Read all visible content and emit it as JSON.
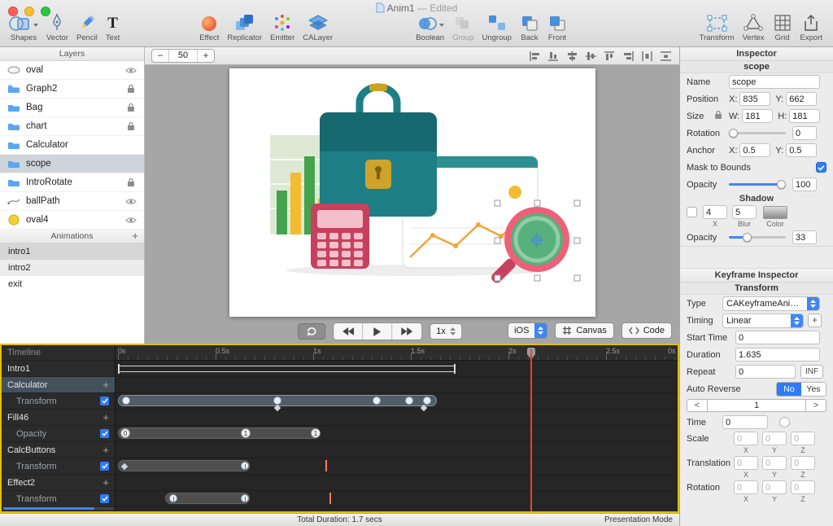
{
  "window": {
    "title_name": "Anim1",
    "title_suffix": "— Edited"
  },
  "icons": {
    "text_tool": "T"
  },
  "toolbar": {
    "shapes": "Shapes",
    "vector": "Vector",
    "pencil": "Pencil",
    "text": "Text",
    "effect": "Effect",
    "replicator": "Replicator",
    "emitter": "Emitter",
    "calayer": "CALayer",
    "boolean": "Boolean",
    "group": "Group",
    "ungroup": "Ungroup",
    "back": "Back",
    "front": "Front",
    "transform": "Transform",
    "vertex": "Vertex",
    "grid": "Grid",
    "export": "Export"
  },
  "layers": {
    "title": "Layers",
    "items": [
      {
        "label": "oval"
      },
      {
        "label": "Graph2"
      },
      {
        "label": "Bag"
      },
      {
        "label": "chart"
      },
      {
        "label": "Calculator"
      },
      {
        "label": "scope"
      },
      {
        "label": "IntroRotate"
      },
      {
        "label": "ballPath"
      },
      {
        "label": "oval4"
      }
    ]
  },
  "animations": {
    "title": "Animations",
    "add": "+",
    "items": [
      {
        "label": "intro1"
      },
      {
        "label": "intro2"
      },
      {
        "label": "exit"
      }
    ]
  },
  "canvas": {
    "zoom_out": "−",
    "zoom_level": "50",
    "zoom_in": "+"
  },
  "playback": {
    "speed": "1x",
    "platform": "iOS",
    "canvas_label": "Canvas",
    "code_label": "Code"
  },
  "inspector": {
    "title": "Inspector",
    "layer_name": "scope",
    "name_label": "Name",
    "name_value": "scope",
    "position_label": "Position",
    "x_label": "X:",
    "y_label": "Y:",
    "pos_x": "835",
    "pos_y": "662",
    "size_label": "Size",
    "w_label": "W:",
    "h_label": "H:",
    "size_w": "181",
    "size_h": "181",
    "rotation_label": "Rotation",
    "rotation_value": "0",
    "anchor_label": "Anchor",
    "anchor_x": "0.5",
    "anchor_y": "0.5",
    "mask_label": "Mask to Bounds",
    "opacity_label": "Opacity",
    "opacity_value": "100",
    "shadow_title": "Shadow",
    "shadow_x": "4",
    "shadow_x_label": "X",
    "shadow_blur": "5",
    "shadow_blur_label": "Blur",
    "shadow_color_label": "Color",
    "shadow_opacity_label": "Opacity",
    "shadow_opacity": "33"
  },
  "keyframe": {
    "title": "Keyframe Inspector",
    "subtitle": "Transform",
    "type_label": "Type",
    "type_value": "CAKeyframeAni…",
    "timing_label": "Timing",
    "timing_value": "Linear",
    "add": "+",
    "start_label": "Start Time",
    "start_value": "0",
    "duration_label": "Duration",
    "duration_value": "1.635",
    "repeat_label": "Repeat",
    "repeat_value": "0",
    "inf": "INF",
    "reverse_label": "Auto Reverse",
    "no": "No",
    "yes": "Yes",
    "prev": "<",
    "index": "1",
    "next": ">",
    "time_label": "Time",
    "time_value": "0",
    "scale_label": "Scale",
    "translation_label": "Translation",
    "rotation_label": "Rotation",
    "x": "X",
    "y": "Y",
    "z": "Z",
    "zero": "0"
  },
  "timeline": {
    "header": "Timeline",
    "add": "+",
    "ruler": [
      "0s",
      "0.5s",
      "1s",
      "1.5s",
      "2s",
      "2.5s",
      "0s"
    ],
    "rows": [
      {
        "label": "Intro1"
      },
      {
        "label": "Calculator"
      },
      {
        "label": "Transform"
      },
      {
        "label": "Fill46"
      },
      {
        "label": "Opacity"
      },
      {
        "label": "CalcButtons"
      },
      {
        "label": "Transform"
      },
      {
        "label": "Effect2"
      },
      {
        "label": "Transform"
      }
    ],
    "marker_zero": "0",
    "marker_one": "1"
  },
  "statusbar": {
    "duration": "Total Duration: 1.7 secs",
    "mode": "Presentation Mode"
  }
}
